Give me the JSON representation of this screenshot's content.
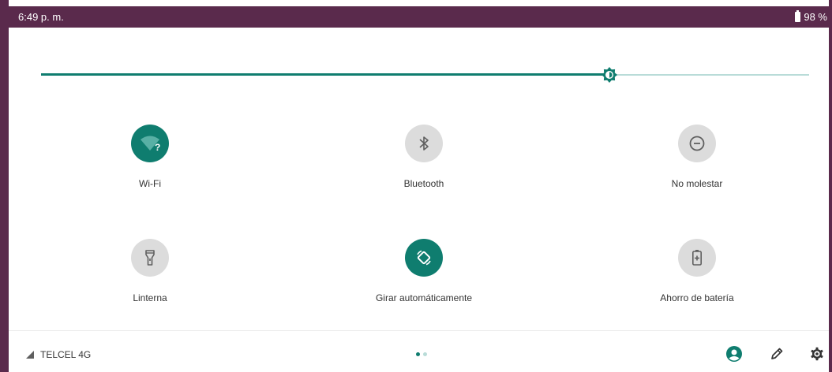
{
  "status_bar": {
    "time": "6:49 p. m.",
    "battery": "98 %"
  },
  "brightness": {
    "level": 0.74
  },
  "tiles": [
    {
      "label": "Wi-Fi",
      "icon": "wifi-question-icon",
      "active": true
    },
    {
      "label": "Bluetooth",
      "icon": "bluetooth-icon",
      "active": false
    },
    {
      "label": "No molestar",
      "icon": "do-not-disturb-icon",
      "active": false
    },
    {
      "label": "Linterna",
      "icon": "flashlight-icon",
      "active": false
    },
    {
      "label": "Girar automáticamente",
      "icon": "auto-rotate-icon",
      "active": true
    },
    {
      "label": "Ahorro de batería",
      "icon": "battery-saver-icon",
      "active": false
    }
  ],
  "footer": {
    "carrier": "TELCEL 4G",
    "page_indicator": {
      "pages": 2,
      "current": 1
    }
  },
  "colors": {
    "accent": "#0f7d6f",
    "accent_light": "#b9dcd8",
    "status_bar": "#5a2a4c",
    "tile_off": "#dcdcdc"
  }
}
